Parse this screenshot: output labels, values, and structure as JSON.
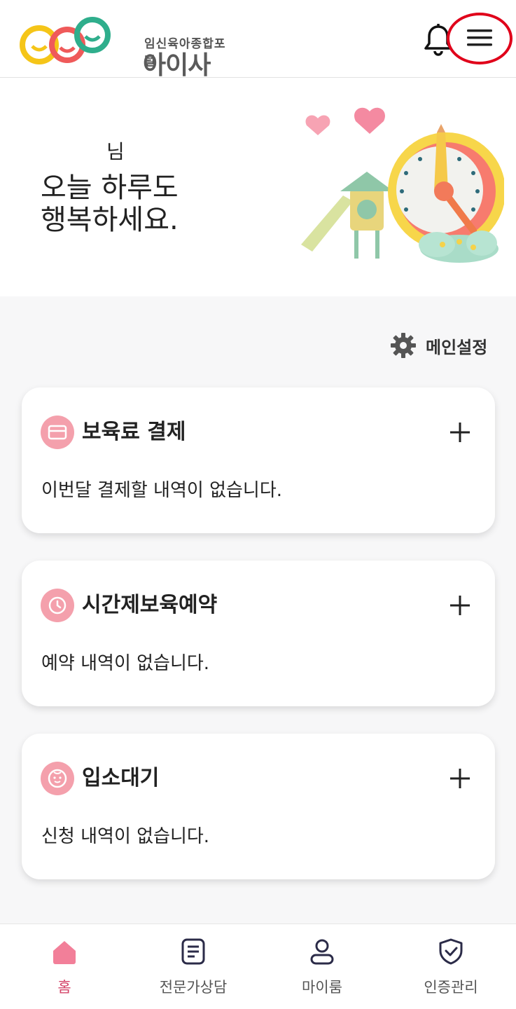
{
  "header": {
    "logo_subtitle": "임신육아종합포털",
    "logo_title": "아이사랑"
  },
  "hero": {
    "name_suffix": "님",
    "message": "오늘 하루도\n행복하세요."
  },
  "settings": {
    "label": "메인설정"
  },
  "cards": [
    {
      "title": "보육료 결제",
      "body": "이번달 결제할 내역이 없습니다.",
      "icon": "card-icon"
    },
    {
      "title": "시간제보육예약",
      "body": "예약 내역이 없습니다.",
      "icon": "clock-icon"
    },
    {
      "title": "입소대기",
      "body": "신청 내역이 없습니다.",
      "icon": "baby-face-icon"
    }
  ],
  "bottom_nav": [
    {
      "label": "홈",
      "icon": "home-icon",
      "active": true
    },
    {
      "label": "전문가상담",
      "icon": "document-icon",
      "active": false
    },
    {
      "label": "마이룸",
      "icon": "person-icon",
      "active": false
    },
    {
      "label": "인증관리",
      "icon": "shield-check-icon",
      "active": false
    }
  ],
  "colors": {
    "accent_pink": "#f4a0ac",
    "active_nav": "#d4456a",
    "highlight_ring": "#e0001a"
  }
}
